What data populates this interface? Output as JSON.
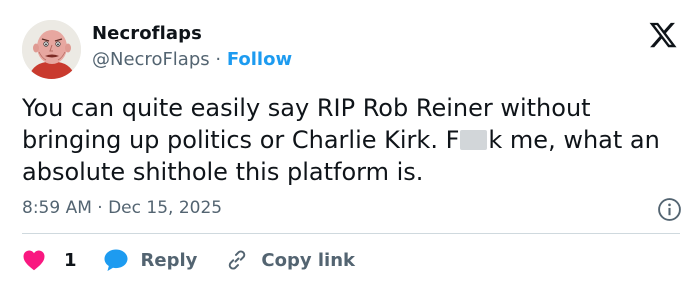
{
  "user": {
    "name": "Necroflaps",
    "handle": "@NecroFlaps",
    "separator": " · ",
    "follow_label": "Follow"
  },
  "tweet": {
    "text_before_redaction": "You can quite easily say RIP Rob Reiner without bringing up politics or Charlie Kirk. F",
    "text_after_redaction": "k me, what an absolute shithole this platform is.",
    "timestamp": "8:59 AM · Dec 15, 2025"
  },
  "actions": {
    "like_count": "1",
    "reply_label": "Reply",
    "copy_label": "Copy link"
  },
  "colors": {
    "accent": "#1d9bf0",
    "like": "#f91880",
    "secondary_text": "#536471"
  },
  "icons": [
    "avatar-image",
    "x-logo-icon",
    "info-icon",
    "heart-icon",
    "reply-bubble-icon",
    "link-icon"
  ]
}
